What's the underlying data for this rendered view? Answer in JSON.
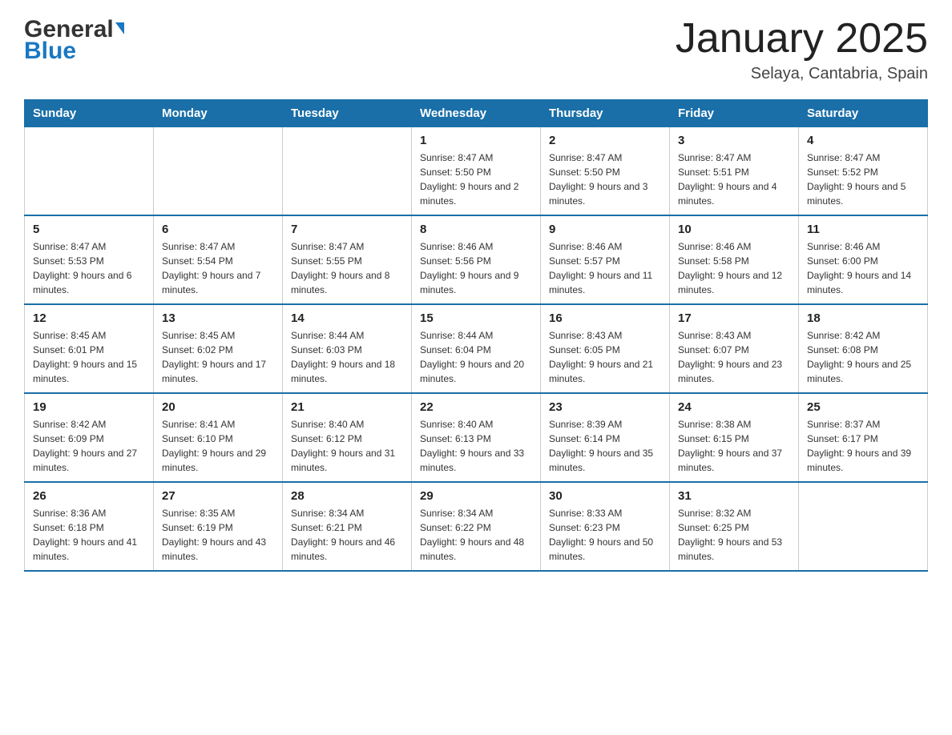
{
  "header": {
    "logo_general": "General",
    "logo_blue": "Blue",
    "month_year": "January 2025",
    "location": "Selaya, Cantabria, Spain"
  },
  "days_of_week": [
    "Sunday",
    "Monday",
    "Tuesday",
    "Wednesday",
    "Thursday",
    "Friday",
    "Saturday"
  ],
  "weeks": [
    [
      {
        "day": "",
        "info": ""
      },
      {
        "day": "",
        "info": ""
      },
      {
        "day": "",
        "info": ""
      },
      {
        "day": "1",
        "info": "Sunrise: 8:47 AM\nSunset: 5:50 PM\nDaylight: 9 hours and 2 minutes."
      },
      {
        "day": "2",
        "info": "Sunrise: 8:47 AM\nSunset: 5:50 PM\nDaylight: 9 hours and 3 minutes."
      },
      {
        "day": "3",
        "info": "Sunrise: 8:47 AM\nSunset: 5:51 PM\nDaylight: 9 hours and 4 minutes."
      },
      {
        "day": "4",
        "info": "Sunrise: 8:47 AM\nSunset: 5:52 PM\nDaylight: 9 hours and 5 minutes."
      }
    ],
    [
      {
        "day": "5",
        "info": "Sunrise: 8:47 AM\nSunset: 5:53 PM\nDaylight: 9 hours and 6 minutes."
      },
      {
        "day": "6",
        "info": "Sunrise: 8:47 AM\nSunset: 5:54 PM\nDaylight: 9 hours and 7 minutes."
      },
      {
        "day": "7",
        "info": "Sunrise: 8:47 AM\nSunset: 5:55 PM\nDaylight: 9 hours and 8 minutes."
      },
      {
        "day": "8",
        "info": "Sunrise: 8:46 AM\nSunset: 5:56 PM\nDaylight: 9 hours and 9 minutes."
      },
      {
        "day": "9",
        "info": "Sunrise: 8:46 AM\nSunset: 5:57 PM\nDaylight: 9 hours and 11 minutes."
      },
      {
        "day": "10",
        "info": "Sunrise: 8:46 AM\nSunset: 5:58 PM\nDaylight: 9 hours and 12 minutes."
      },
      {
        "day": "11",
        "info": "Sunrise: 8:46 AM\nSunset: 6:00 PM\nDaylight: 9 hours and 14 minutes."
      }
    ],
    [
      {
        "day": "12",
        "info": "Sunrise: 8:45 AM\nSunset: 6:01 PM\nDaylight: 9 hours and 15 minutes."
      },
      {
        "day": "13",
        "info": "Sunrise: 8:45 AM\nSunset: 6:02 PM\nDaylight: 9 hours and 17 minutes."
      },
      {
        "day": "14",
        "info": "Sunrise: 8:44 AM\nSunset: 6:03 PM\nDaylight: 9 hours and 18 minutes."
      },
      {
        "day": "15",
        "info": "Sunrise: 8:44 AM\nSunset: 6:04 PM\nDaylight: 9 hours and 20 minutes."
      },
      {
        "day": "16",
        "info": "Sunrise: 8:43 AM\nSunset: 6:05 PM\nDaylight: 9 hours and 21 minutes."
      },
      {
        "day": "17",
        "info": "Sunrise: 8:43 AM\nSunset: 6:07 PM\nDaylight: 9 hours and 23 minutes."
      },
      {
        "day": "18",
        "info": "Sunrise: 8:42 AM\nSunset: 6:08 PM\nDaylight: 9 hours and 25 minutes."
      }
    ],
    [
      {
        "day": "19",
        "info": "Sunrise: 8:42 AM\nSunset: 6:09 PM\nDaylight: 9 hours and 27 minutes."
      },
      {
        "day": "20",
        "info": "Sunrise: 8:41 AM\nSunset: 6:10 PM\nDaylight: 9 hours and 29 minutes."
      },
      {
        "day": "21",
        "info": "Sunrise: 8:40 AM\nSunset: 6:12 PM\nDaylight: 9 hours and 31 minutes."
      },
      {
        "day": "22",
        "info": "Sunrise: 8:40 AM\nSunset: 6:13 PM\nDaylight: 9 hours and 33 minutes."
      },
      {
        "day": "23",
        "info": "Sunrise: 8:39 AM\nSunset: 6:14 PM\nDaylight: 9 hours and 35 minutes."
      },
      {
        "day": "24",
        "info": "Sunrise: 8:38 AM\nSunset: 6:15 PM\nDaylight: 9 hours and 37 minutes."
      },
      {
        "day": "25",
        "info": "Sunrise: 8:37 AM\nSunset: 6:17 PM\nDaylight: 9 hours and 39 minutes."
      }
    ],
    [
      {
        "day": "26",
        "info": "Sunrise: 8:36 AM\nSunset: 6:18 PM\nDaylight: 9 hours and 41 minutes."
      },
      {
        "day": "27",
        "info": "Sunrise: 8:35 AM\nSunset: 6:19 PM\nDaylight: 9 hours and 43 minutes."
      },
      {
        "day": "28",
        "info": "Sunrise: 8:34 AM\nSunset: 6:21 PM\nDaylight: 9 hours and 46 minutes."
      },
      {
        "day": "29",
        "info": "Sunrise: 8:34 AM\nSunset: 6:22 PM\nDaylight: 9 hours and 48 minutes."
      },
      {
        "day": "30",
        "info": "Sunrise: 8:33 AM\nSunset: 6:23 PM\nDaylight: 9 hours and 50 minutes."
      },
      {
        "day": "31",
        "info": "Sunrise: 8:32 AM\nSunset: 6:25 PM\nDaylight: 9 hours and 53 minutes."
      },
      {
        "day": "",
        "info": ""
      }
    ]
  ]
}
